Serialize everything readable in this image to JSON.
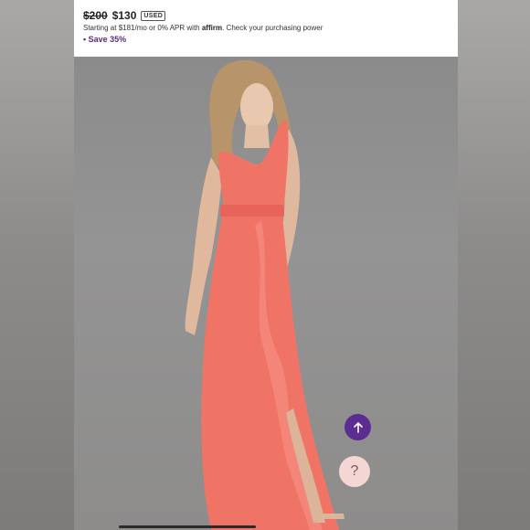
{
  "listing": {
    "original_price": "$200",
    "price": "$130",
    "condition_badge": "USED",
    "financing_prefix": "Starting at $181/mo or 0% APR with",
    "financing_brand": "affirm",
    "financing_suffix": ". Check your purchasing power",
    "discount": "• Save 35%"
  },
  "buttons": {
    "scroll_top_icon": "arrow-up-icon",
    "help_icon": "question-icon",
    "help_label": "?"
  },
  "colors": {
    "accent_purple": "#5c2d91",
    "dress_coral": "#f07466",
    "help_bg": "#f4d6d4"
  }
}
